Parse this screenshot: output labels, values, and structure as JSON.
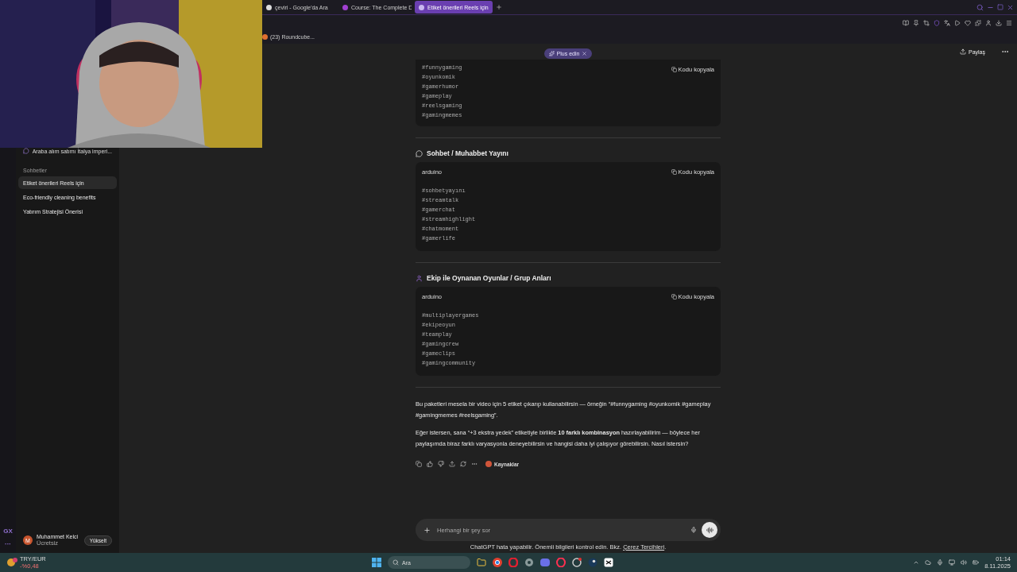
{
  "browser": {
    "tabs": [
      {
        "label": "çeviri - Google'da Ara",
        "selected": false,
        "kind": "google"
      },
      {
        "label": "Course: The Complete D",
        "selected": false,
        "kind": "course"
      },
      {
        "label": "Etiket önerileri Reels için",
        "selected": true,
        "kind": "chat"
      }
    ],
    "bookmarks": [
      "(23) Roundcube..."
    ]
  },
  "header": {
    "upgrade": "Plus edin",
    "share": "Paylaş"
  },
  "sidebar": {
    "pinned": "Araba alım satımı İtalya imperi...",
    "section": "Sohbetler",
    "chats": [
      {
        "label": "Etiket önerileri Reels için",
        "selected": true
      },
      {
        "label": "Eco-friendly cleaning benefits",
        "selected": false
      },
      {
        "label": "Yatırım Stratejisi Önerisi",
        "selected": false
      }
    ],
    "user": {
      "initial": "M",
      "name": "Muhammet Kelci",
      "plan": "Ücretsiz",
      "button": "Yükselt"
    },
    "rail": [
      "GX",
      "···"
    ]
  },
  "sections": [
    {
      "copy": "Kodu kopyala",
      "lines": [
        "#funnygaming",
        "#oyunkomik",
        "#gamerhumor",
        "#gameplay",
        "#reelsgaming",
        "#gamingmemes"
      ]
    },
    {
      "kind": "chat",
      "heading": "Sohbet / Muhabbet Yayını",
      "lang": "arduino",
      "copy": "Kodu kopyala",
      "lines": [
        "#sohbetyayını",
        "#streamtalk",
        "#gamerchat",
        "#streamhighlight",
        "#chatmoment",
        "#gamerlife"
      ]
    },
    {
      "kind": "group",
      "heading": "Ekip ile Oynanan Oyunlar / Grup Anları",
      "lang": "arduino",
      "copy": "Kodu kopyala",
      "lines": [
        "#multiplayergames",
        "#ekipeoyun",
        "#teamplay",
        "#gamingcrew",
        "#gameclips",
        "#gamingcommunity"
      ]
    }
  ],
  "paragraphs": [
    "Bu paketleri mesela bir video için 5 etiket çıkarıp kullanabilirsin — örneğin “#funnygaming #oyunkomik #gameplay #gamingmemes #reelsgaming”.",
    "Eğer istersen, sana “+3 ekstra yedek” etiketiyle birlikte **10 farklı kombinasyon** hazırlayabilirim — böylece her paylaşımda biraz farklı varyasyonla deneyebilirsin ve hangisi daha iyi çalışıyor görebilirsin. Nasıl istersin?"
  ],
  "actions": {
    "sources": "Kaynaklar"
  },
  "composer": {
    "placeholder": "Herhangi bir şey sor"
  },
  "disclaimer": {
    "text": "ChatGPT hata yapabilir. Önemli bilgileri kontrol edin. Bkz.",
    "link": "Çerez Tercihleri",
    "suffix": "."
  },
  "taskbar": {
    "widget": {
      "pair": "TRY/EUR",
      "change": "-%0,48"
    },
    "search": "Ara",
    "time": "01:14",
    "date": "8.11.2025"
  }
}
